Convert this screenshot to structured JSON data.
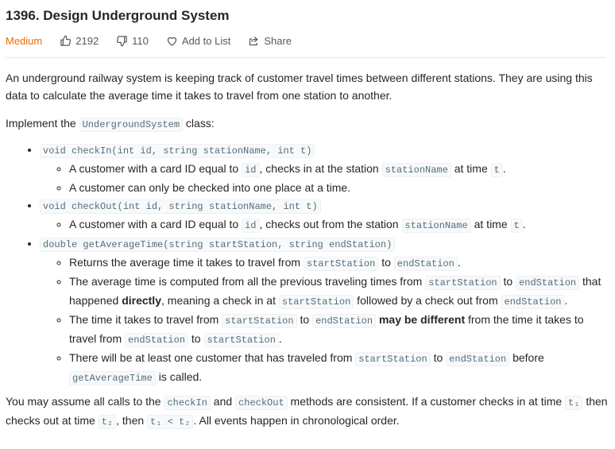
{
  "problem": {
    "title": "1396. Design Underground System",
    "difficulty": "Medium",
    "likes": "2192",
    "dislikes": "110",
    "add_to_list": "Add to List",
    "share": "Share"
  },
  "description": {
    "p1": "An underground railway system is keeping track of customer travel times between different stations. They are using this data to calculate the average time it takes to travel from one station to another.",
    "implement_prefix": "Implement the ",
    "class_name": "UndergroundSystem",
    "implement_suffix": " class:",
    "methods": {
      "checkin": {
        "signature": "void checkIn(int id, string stationName, int t)",
        "b1": [
          "A customer with a card ID equal to ",
          "id",
          ", checks in at the station ",
          "stationName",
          " at time ",
          "t",
          "."
        ],
        "b2": "A customer can only be checked into one place at a time."
      },
      "checkout": {
        "signature": "void checkOut(int id, string stationName, int t)",
        "b1": [
          "A customer with a card ID equal to ",
          "id",
          ", checks out from the station ",
          "stationName",
          " at time ",
          "t",
          "."
        ]
      },
      "avg": {
        "signature": "double getAverageTime(string startStation, string endStation)",
        "b1": [
          "Returns the average time it takes to travel from ",
          "startStation",
          " to ",
          "endStation",
          "."
        ],
        "b2": [
          "The average time is computed from all the previous traveling times from ",
          "startStation",
          " to ",
          "endStation",
          " that happened ",
          "directly",
          ", meaning a check in at ",
          "startStation",
          " followed by a check out from ",
          "endStation",
          "."
        ],
        "b3": [
          "The time it takes to travel from ",
          "startStation",
          " to ",
          "endStation",
          " ",
          "may be different",
          " from the time it takes to travel from ",
          "endStation",
          " to ",
          "startStation",
          "."
        ],
        "b4": [
          "There will be at least one customer that has traveled from ",
          "startStation",
          " to ",
          "endStation",
          " before ",
          "getAverageTime",
          " is called."
        ]
      }
    },
    "p3": [
      "You may assume all calls to the ",
      "checkIn",
      " and ",
      "checkOut",
      " methods are consistent. If a customer checks in at time ",
      "t₁",
      " then checks out at time ",
      "t₂",
      ", then ",
      "t₁ < t₂",
      ". All events happen in chronological order."
    ]
  },
  "colors": {
    "difficulty": "#ef6c00",
    "code_text": "#546e7a",
    "code_bg": "#f7f9fa"
  },
  "icons": {
    "like": "thumbs-up-icon",
    "dislike": "thumbs-down-icon",
    "add": "heart-icon",
    "share": "share-icon"
  }
}
